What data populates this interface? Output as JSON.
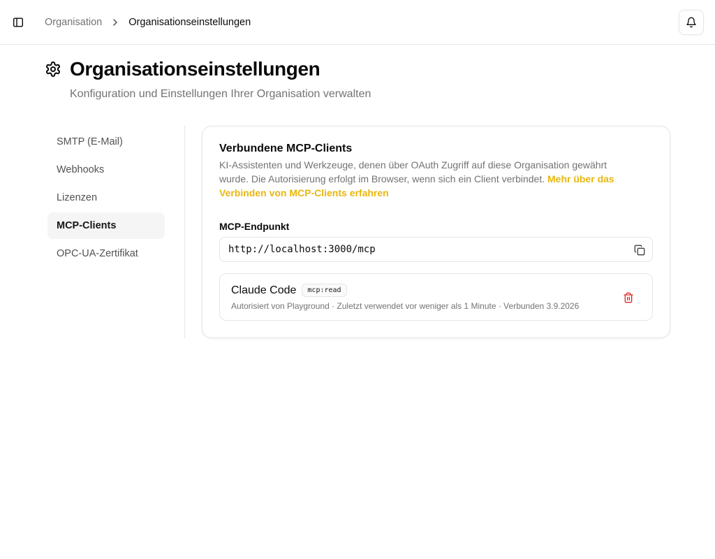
{
  "header": {
    "breadcrumb_parent": "Organisation",
    "breadcrumb_current": "Organisationseinstellungen"
  },
  "page": {
    "title": "Organisationseinstellungen",
    "subtitle": "Konfiguration und Einstellungen Ihrer Organisation verwalten"
  },
  "nav": {
    "items": [
      {
        "label": "SMTP (E-Mail)"
      },
      {
        "label": "Webhooks"
      },
      {
        "label": "Lizenzen"
      },
      {
        "label": "MCP-Clients"
      },
      {
        "label": "OPC-UA-Zertifikat"
      }
    ],
    "active": "MCP-Clients"
  },
  "card": {
    "title": "Verbundene MCP-Clients",
    "description": "KI-Assistenten und Werkzeuge, denen über OAuth Zugriff auf diese Organisation gewährt wurde. Die Autorisierung erfolgt im Browser, wenn sich ein Client verbindet.",
    "link_text": "Mehr über das Verbinden von MCP-Clients erfahren",
    "endpoint_label": "MCP-Endpunkt",
    "endpoint_value": "http://localhost:3000/mcp",
    "clients": [
      {
        "name": "Claude Code",
        "scope": "mcp:read",
        "meta": "Autorisiert von Playground · Zuletzt verwendet vor weniger als 1 Minute · Verbunden 3.9.2026"
      }
    ]
  },
  "icons": {
    "sidebar_toggle": "sidebar-icon",
    "chevron": "chevron-right-icon",
    "bell": "bell-icon",
    "settings": "gear-icon",
    "copy": "copy-icon",
    "delete": "trash-icon"
  },
  "colors": {
    "link": "#e8b70f",
    "danger": "#dc2626",
    "muted_text": "#737373",
    "border": "#e5e5e5",
    "active_nav_bg": "#f5f5f5"
  }
}
